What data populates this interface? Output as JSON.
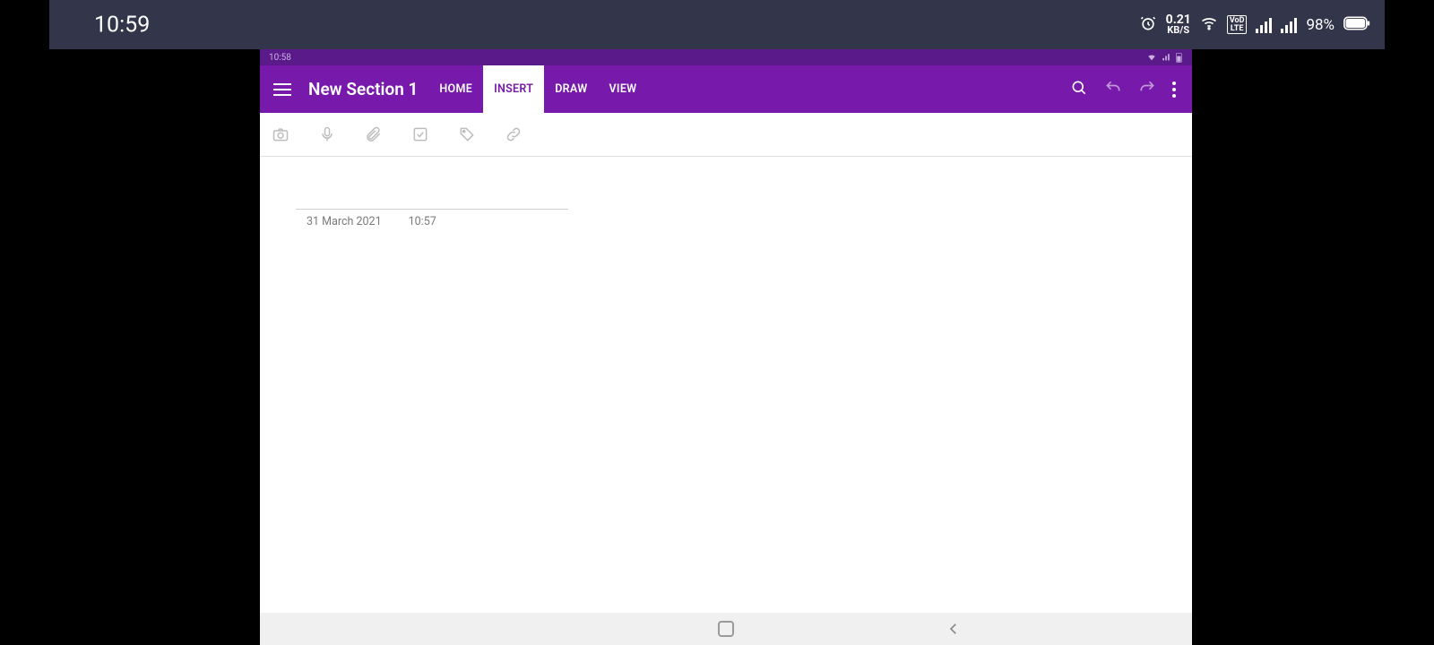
{
  "outer_status": {
    "clock": "10:59",
    "data_rate": "0.21",
    "data_unit": "KB/S",
    "network": "VoLTE",
    "battery_pct": "98%"
  },
  "inner_status": {
    "clock": "10:58"
  },
  "appbar": {
    "section_title": "New Section 1",
    "tabs": [
      {
        "label": "HOME",
        "active": false
      },
      {
        "label": "INSERT",
        "active": true
      },
      {
        "label": "DRAW",
        "active": false
      },
      {
        "label": "VIEW",
        "active": false
      }
    ],
    "actions": {
      "search": "search-icon",
      "undo": "undo-icon",
      "redo": "redo-icon",
      "more": "more-icon"
    }
  },
  "insert_toolbar": {
    "items": [
      "camera-icon",
      "microphone-icon",
      "attachment-icon",
      "checkbox-icon",
      "tag-icon",
      "link-icon"
    ]
  },
  "page": {
    "title": "",
    "date": "31 March 2021",
    "time": "10:57"
  },
  "colors": {
    "primary": "#7719aa"
  }
}
